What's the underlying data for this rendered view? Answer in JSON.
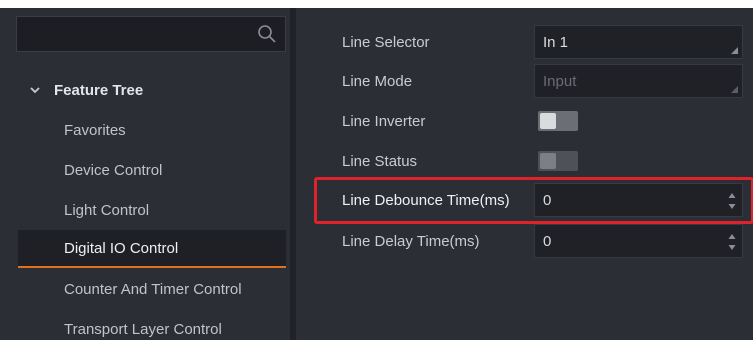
{
  "search": {
    "value": "",
    "icon": "search-icon"
  },
  "tree": {
    "title": "Feature Tree",
    "items": [
      {
        "label": "Favorites"
      },
      {
        "label": "Device Control"
      },
      {
        "label": "Light Control"
      },
      {
        "label": "Digital IO Control"
      },
      {
        "label": "Counter And Timer Control"
      },
      {
        "label": "Transport Layer Control"
      }
    ],
    "selected": "Digital IO Control"
  },
  "properties": [
    {
      "label": "Line Selector",
      "value": "In 1",
      "control": "dropdown"
    },
    {
      "label": "Line Mode",
      "value": "Input",
      "control": "dropdown-disabled"
    },
    {
      "label": "Line Inverter",
      "control": "toggle",
      "on": false
    },
    {
      "label": "Line Status",
      "control": "toggle-disabled",
      "on": false
    },
    {
      "label": "Line Debounce Time(ms)",
      "value": "0",
      "control": "spinbox",
      "highlighted": true
    },
    {
      "label": "Line Delay Time(ms)",
      "value": "0",
      "control": "spinbox"
    }
  ],
  "colors": {
    "panel_bg": "#2b2e35",
    "accent_orange": "#e0701b",
    "highlight_red": "#e0232b"
  }
}
